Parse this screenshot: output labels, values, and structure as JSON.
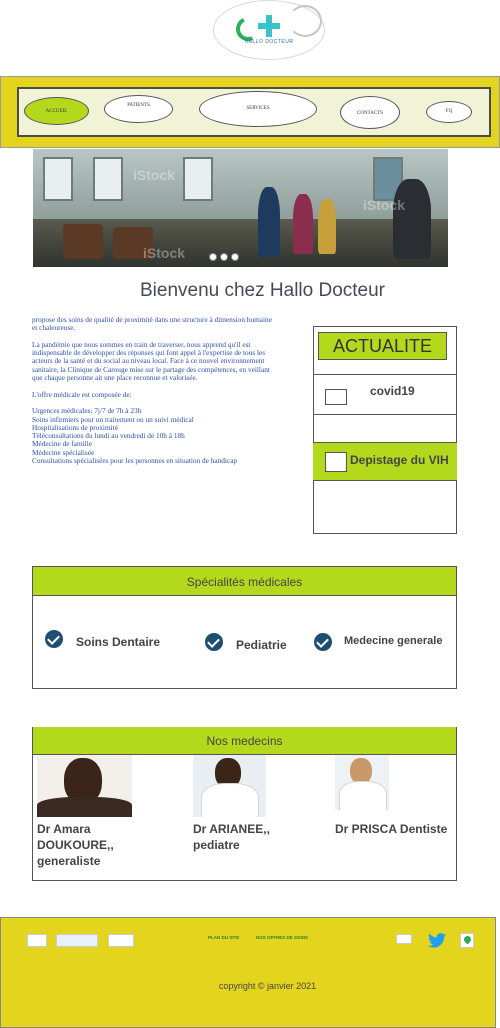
{
  "logo": {
    "text": "HALLO DOCTEUR"
  },
  "nav": {
    "items": [
      {
        "label": "ACCUEIL"
      },
      {
        "label": "PATIENTS"
      },
      {
        "label": "SERVICES"
      },
      {
        "label": "CONTACTS"
      },
      {
        "label": "FQ"
      }
    ],
    "active_index": 0
  },
  "hero": {
    "watermark": "iStock",
    "slide_count": 3
  },
  "page_title": "Bienvenu chez Hallo Docteur",
  "intro": {
    "paragraph1": "propose des soins de qualité de proximité dans une structure à dimension humaine et chaleureuse.",
    "paragraph2": "La pandémie que nous sommes en train de traverser, nous apprend qu'il est indispensable de développer des réponses qui font appel à l'expertise de tous les acteurs de la santé et du social au niveau local. Face à ce nouvel environnement sanitaire, la Clinique de Carouge mise sur le partage des compétences, en veillant que chaque personne ait une place reconnue et valorisée.",
    "offer_heading": "L'offre médicale est composée de:",
    "offer_items": [
      "Urgences médicales: 7j/7 de 7h à 23h",
      "Soins infirmiers pour un traitement ou un suivi médical",
      "Hospitalisations de proximité",
      "Téléconsultations du lundi au vendredi de 10h à 18h",
      "Médecine de famille",
      "Médecine spécialisée",
      "Consultations spécialisées pour les personnes en situation de handicap"
    ]
  },
  "actualite": {
    "title": "ACTUALITE",
    "items": [
      {
        "label": "covid19"
      },
      {
        "label": "Depistage du VIH"
      }
    ]
  },
  "specialites": {
    "title": "Spécialités médicales",
    "items": [
      {
        "label": "Soins Dentaire"
      },
      {
        "label": "Pediatrie"
      },
      {
        "label": "Medecine generale"
      }
    ]
  },
  "medecins": {
    "title": "Nos medecins",
    "doctors": [
      {
        "name_line1": "Dr Amara",
        "name_line2": "DOUKOURE,,",
        "name_line3": "generaliste"
      },
      {
        "name_line1": "Dr ARIANEE,,",
        "name_line2": "pediatre"
      },
      {
        "name_line1": "Dr PRISCA Dentiste"
      }
    ]
  },
  "footer": {
    "links": [
      {
        "label": "PLAN DU SITE"
      },
      {
        "label": "NOS OFFRES DE SOINS"
      }
    ],
    "copyright": "copyright ©  janvier 2021",
    "colors": {
      "background": "#e3d51e",
      "accent": "#b4d91c"
    }
  }
}
